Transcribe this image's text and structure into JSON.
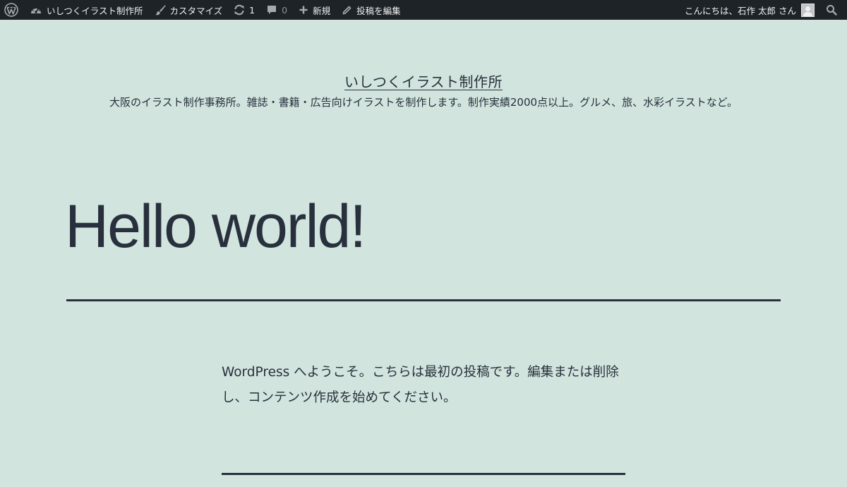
{
  "admin_bar": {
    "site_name": "いしつくイラスト制作所",
    "customize": "カスタマイズ",
    "updates_count": "1",
    "comments_count": "0",
    "new_label": "新規",
    "edit_post": "投稿を編集",
    "greeting": "こんにちは、石作 太郎 さん",
    "icons": [
      "wordpress-logo-icon",
      "dashboard-icon",
      "paintbrush-icon",
      "updates-icon",
      "comment-icon",
      "plus-icon",
      "pencil-icon",
      "avatar",
      "search-icon"
    ]
  },
  "site": {
    "title": "いしつくイラスト制作所",
    "description": "大阪のイラスト制作事務所。雑誌・書籍・広告向けイラストを制作します。制作実績2000点以上。グルメ、旅、水彩イラストなど。"
  },
  "post": {
    "title": "Hello world!",
    "content": "WordPress へようこそ。こちらは最初の投稿です。編集または削除し、コンテンツ作成を始めてください。"
  },
  "colors": {
    "background": "#d1e4dd",
    "admin_bar": "#1d2327",
    "text": "#28303d"
  }
}
